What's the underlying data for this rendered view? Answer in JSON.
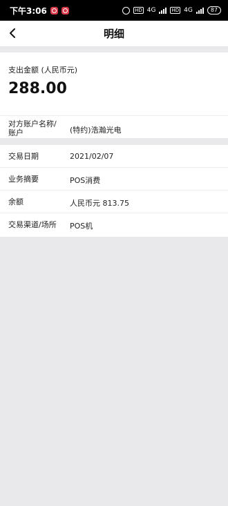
{
  "status_bar": {
    "time": "下午3:06",
    "network_1": "4G",
    "hd_1": "HD",
    "network_2": "4G",
    "battery": "87"
  },
  "nav": {
    "title": "明细"
  },
  "summary": {
    "amount_label": "支出金额 (人民币元)",
    "amount": "288.00",
    "counterparty_label": "对方账户名称/账户",
    "counterparty_value": "(特约)浩瀚光电"
  },
  "details": [
    {
      "label": "交易日期",
      "value": "2021/02/07"
    },
    {
      "label": "业务摘要",
      "value": "POS消费"
    },
    {
      "label": "余额",
      "value": "人民币元 813.75"
    },
    {
      "label": "交易渠道/场所",
      "value": "POS机"
    }
  ]
}
